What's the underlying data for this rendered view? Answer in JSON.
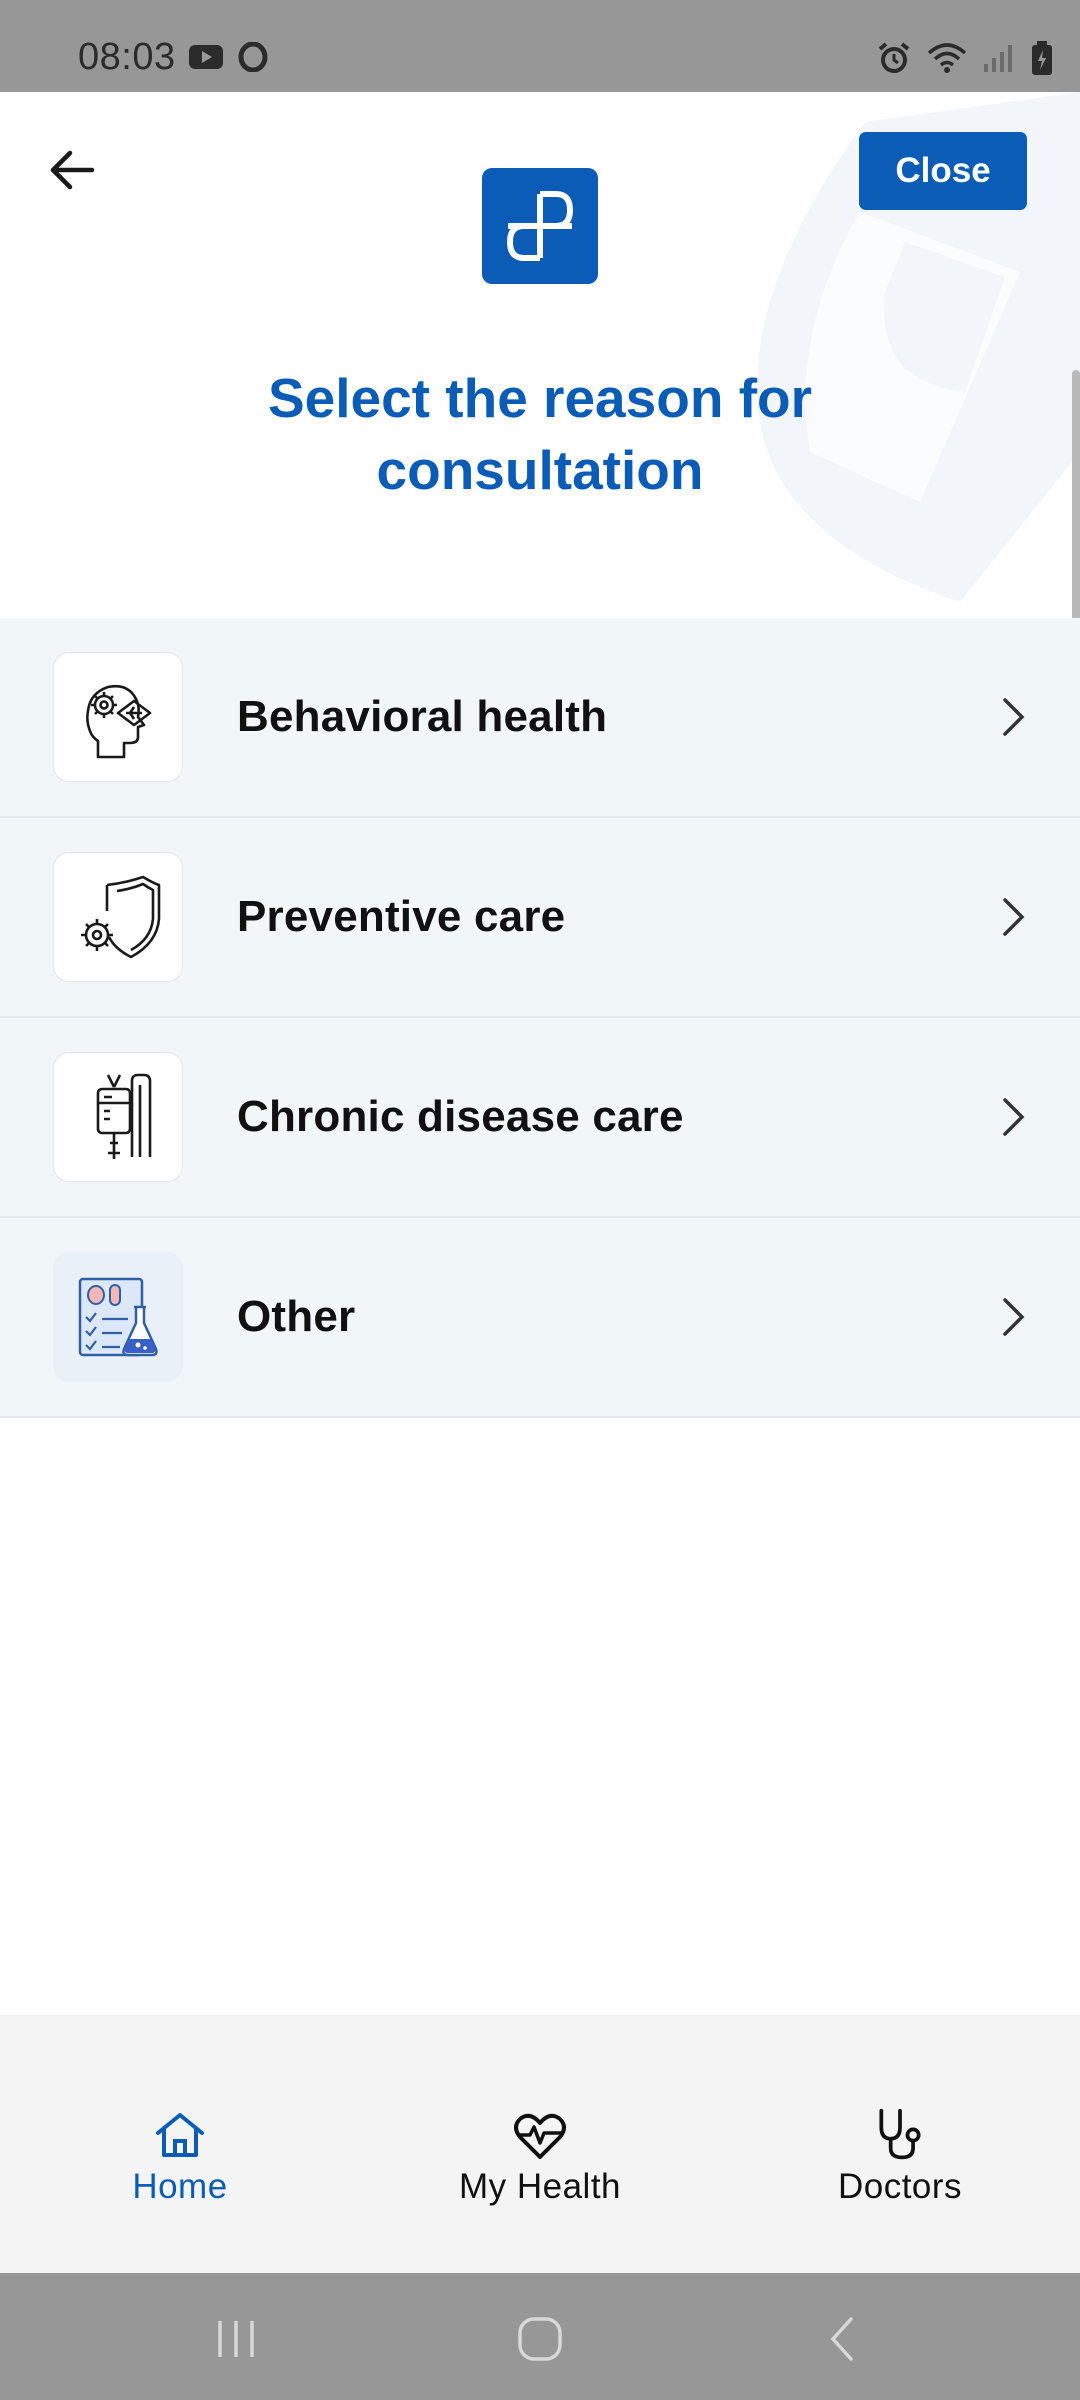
{
  "status_bar": {
    "time": "08:03",
    "left_icons": [
      "youtube-icon",
      "opera-icon"
    ],
    "right_icons": [
      "alarm-icon",
      "wifi-icon",
      "signal-icon",
      "battery-icon"
    ]
  },
  "header": {
    "back_icon": "arrow-left-icon",
    "logo_icon": "app-logo-icon",
    "close_label": "Close",
    "title": "Select the reason for consultation"
  },
  "reasons": [
    {
      "label": "Behavioral health",
      "icon": "head-gears-icon"
    },
    {
      "label": "Preventive care",
      "icon": "shield-virus-icon"
    },
    {
      "label": "Chronic disease care",
      "icon": "iv-drip-icon"
    },
    {
      "label": "Other",
      "icon": "lab-clipboard-icon"
    }
  ],
  "bottom_nav": [
    {
      "label": "Home",
      "icon": "home-icon",
      "active": true
    },
    {
      "label": "My Health",
      "icon": "heart-pulse-icon",
      "active": false
    },
    {
      "label": "Doctors",
      "icon": "stethoscope-icon",
      "active": false
    }
  ],
  "system_nav": [
    "recent-apps-icon",
    "home-button-icon",
    "back-button-icon"
  ],
  "colors": {
    "primary": "#0a5cb7",
    "list_bg": "#f1f6f9",
    "nav_bg": "#f4f4f4",
    "system_bar": "#979797"
  }
}
